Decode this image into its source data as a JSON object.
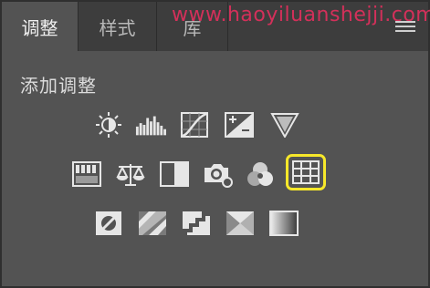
{
  "tabs": [
    {
      "label": "调整",
      "active": true
    },
    {
      "label": "样式",
      "active": false
    },
    {
      "label": "库",
      "active": false
    }
  ],
  "watermark": "www.haoyiluanshejji.com",
  "section_title": "添加调整",
  "colors": {
    "panel_bg": "#535353",
    "tab_bar_bg": "#3d3d3d",
    "icon_fill": "#e6e6e6",
    "highlight": "#f7e82a",
    "watermark": "#d3305a"
  },
  "adjustment_rows": [
    [
      "brightness-contrast",
      "levels",
      "curves",
      "exposure",
      "vibrance"
    ],
    [
      "hue-saturation",
      "color-balance",
      "black-white",
      "photo-filter",
      "channel-mixer",
      "color-lookup"
    ],
    [
      "invert",
      "posterize",
      "threshold",
      "selective-color",
      "gradient-map"
    ]
  ],
  "selected_adjustment": "color-lookup"
}
